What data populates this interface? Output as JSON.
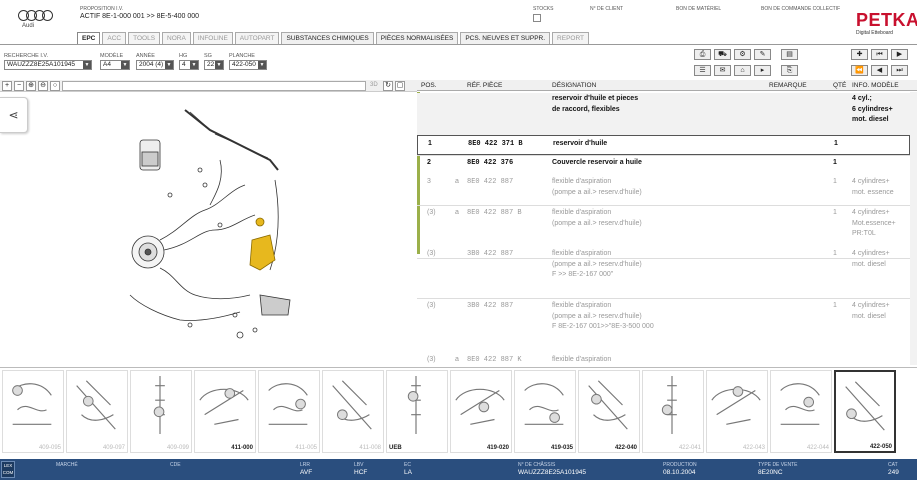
{
  "header": {
    "brand": "Audi",
    "proposition_label": "PROPOSITION I.V.",
    "proposition_value": "ACTIF  8E-1-000 001 >> 8E-5-400 000",
    "stocks_label": "STOCKS",
    "client_label": "N° DE CLIENT",
    "bon_materiel_label": "BON DE MATÉRIEL",
    "bon_commande_label": "BON DE COMMANDE COLLECTIF",
    "app_name": "PETKA",
    "app_sub": "Digital Etteboard"
  },
  "tabs": [
    {
      "label": "EPC",
      "state": "active"
    },
    {
      "label": "ACC",
      "state": "off"
    },
    {
      "label": "TOOLS",
      "state": "off"
    },
    {
      "label": "NORA",
      "state": "off"
    },
    {
      "label": "INFOLINE",
      "state": "off"
    },
    {
      "label": "AUTOPART",
      "state": "off"
    },
    {
      "label": "SUBSTANCES CHIMIQUES",
      "state": "on"
    },
    {
      "label": "PIÈCES NORMALISÉES",
      "state": "on"
    },
    {
      "label": "PCS. NEUVES ET SUPPR.",
      "state": "on"
    },
    {
      "label": "REPORT",
      "state": "off"
    }
  ],
  "filters": {
    "vin_label": "RECHERCHE I.V.",
    "vin_value": "WAUZZZ8E25A101945",
    "model_label": "MODÈLE",
    "model_value": "A4",
    "year_label": "ANNÉE",
    "year_value": "2004 (4)",
    "hg_label": "HG",
    "hg_value": "4",
    "sg_label": "SG",
    "sg_value": "22",
    "planche_label": "PLANCHE",
    "planche_value": "422-050"
  },
  "toolbar_icons": [
    "print-icon",
    "car-icon",
    "gearbox-icon",
    "service-icon",
    "tuning-icon",
    "spacer",
    "pin-icon",
    "first-icon",
    "prev-icon",
    "next-icon",
    "last-icon",
    "list-icon",
    "note-icon",
    "basket-icon",
    "arrow-icon",
    "copy-icon"
  ],
  "zoom_label": "3D",
  "table": {
    "headers": {
      "pos": "POS.",
      "ref": "RÉF. PIÈCE",
      "desc": "DÉSIGNATION",
      "remark": "REMARQUE",
      "qty": "QTÉ",
      "info": "INFO. MODÈLE"
    },
    "group_title": "reservoir d'huile et pieces\nde raccord, flexibles",
    "group_info": "4 cyl.;\n6 cylindres+\nmot. diesel",
    "rows": [
      {
        "pos": "1",
        "sub": "",
        "ref": "8E0  422  371  B",
        "desc": "reservoir d'huile",
        "qty": "1",
        "info": "",
        "style": "bold"
      },
      {
        "pos": "2",
        "sub": "",
        "ref": "8E0  422  376",
        "desc": "Couvercle reservoir a huile",
        "qty": "1",
        "info": "",
        "style": "bold"
      },
      {
        "pos": "3",
        "sub": "a",
        "ref": "8E0  422  887",
        "desc": "flexible d'aspiration\n(pompe a ail.> reserv.d'huile)",
        "qty": "1",
        "info": "4 cylindres+\nmot. essence",
        "style": "grey"
      },
      {
        "pos": "(3)",
        "sub": "a",
        "ref": "8E0  422  887  B",
        "desc": "flexible d'aspiration\n(pompe a ail.> reserv.d'huile)",
        "qty": "1",
        "info": "4 cylindres+\nMot.essence+\nPR:T0L",
        "style": "grey"
      },
      {
        "pos": "(3)",
        "sub": "",
        "ref": "3B0  422  887",
        "desc": "flexible d'aspiration\n(pompe a ail.> reserv.d'huile)\nF           >> 8E-2-167 000\"",
        "qty": "1",
        "info": "4 cylindres+\nmot. diesel",
        "style": "grey"
      },
      {
        "pos": "(3)",
        "sub": "",
        "ref": "3B0  422  887",
        "desc": "flexible d'aspiration\n(pompe a ail.> reserv.d'huile)\nF 8E-2-167 001>>\"8E-3-500 000",
        "qty": "1",
        "info": "4 cylindres+\nmot. diesel",
        "style": "grey"
      },
      {
        "pos": "(3)",
        "sub": "a",
        "ref": "8E0  422  887  K",
        "desc": "flexible d'aspiration",
        "qty": "",
        "info": "",
        "style": "grey"
      }
    ]
  },
  "thumbnails": [
    {
      "caption": "409-095",
      "left_caption": "",
      "active": false
    },
    {
      "caption": "409-097",
      "left_caption": "",
      "active": false
    },
    {
      "caption": "409-099",
      "left_caption": "",
      "active": false
    },
    {
      "caption": "411-000",
      "left_caption": "",
      "active": true
    },
    {
      "caption": "411-005",
      "left_caption": "",
      "active": false
    },
    {
      "caption": "411-008",
      "left_caption": "",
      "active": false
    },
    {
      "caption": "",
      "left_caption": "UEB",
      "active": false
    },
    {
      "caption": "419-020",
      "left_caption": "",
      "active": true
    },
    {
      "caption": "419-035",
      "left_caption": "",
      "active": true
    },
    {
      "caption": "422-040",
      "left_caption": "",
      "active": true
    },
    {
      "caption": "422-041",
      "left_caption": "",
      "active": false
    },
    {
      "caption": "422-043",
      "left_caption": "",
      "active": false
    },
    {
      "caption": "422-044",
      "left_caption": "",
      "active": false
    },
    {
      "caption": "422-050",
      "left_caption": "",
      "active": true
    }
  ],
  "footer": {
    "logo": "LEX COM",
    "fields": [
      {
        "label": "MARCHÉ",
        "value": ""
      },
      {
        "label": "CDE",
        "value": ""
      },
      {
        "label": "LRR",
        "value": "AVF"
      },
      {
        "label": "LBV",
        "value": "HCF"
      },
      {
        "label": "EC",
        "value": "LA"
      },
      {
        "label": "N° DE CHÂSSIS",
        "value": "WAUZZZ8E25A101945"
      },
      {
        "label": "PRODUCTION",
        "value": "08.10.2004"
      },
      {
        "label": "TYPE DE VENTE",
        "value": "8E20NC"
      },
      {
        "label": "CAT",
        "value": "249"
      }
    ]
  },
  "colors": {
    "footer_bg": "#2a4e7e",
    "brand_red": "#c8102e",
    "group_bar": "#9bb04a"
  }
}
